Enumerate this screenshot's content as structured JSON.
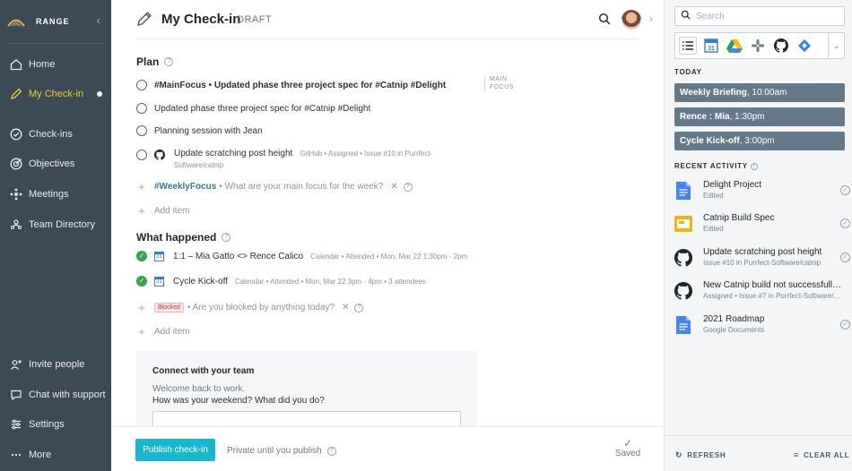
{
  "sidebar": {
    "brand": "RANGE",
    "top_items": [
      {
        "label": "Home",
        "icon": "home-icon"
      },
      {
        "label": "My Check-in",
        "icon": "pencil-icon",
        "active": true
      },
      {
        "label": "Check-ins",
        "icon": "check-circle-icon"
      },
      {
        "label": "Objectives",
        "icon": "target-icon"
      },
      {
        "label": "Meetings",
        "icon": "meetings-icon"
      },
      {
        "label": "Team Directory",
        "icon": "team-icon"
      }
    ],
    "bottom_items": [
      {
        "label": "Invite people",
        "icon": "invite-icon"
      },
      {
        "label": "Chat with support",
        "icon": "chat-icon"
      },
      {
        "label": "Settings",
        "icon": "settings-icon"
      },
      {
        "label": "More",
        "icon": "more-icon"
      }
    ],
    "active_color": "#f4cf2f",
    "background": "#3b4a55"
  },
  "header": {
    "title": "My Check-in",
    "status": "DRAFT"
  },
  "plan": {
    "heading": "Plan",
    "main_focus_label": "MAIN FOCUS",
    "items": [
      {
        "text": "#MainFocus • Updated phase three project spec for #Catnip #Delight"
      },
      {
        "text": "Updated phase three project spec for #Catnip #Delight"
      },
      {
        "text": "Planning session with Jean"
      },
      {
        "text": "Update scratching post height",
        "meta1": "GitHub • Assigned • Issue #10 in Purrfect-",
        "meta2": "Software/catnip"
      }
    ],
    "weekly_focus_tag": "#WeeklyFocus",
    "weekly_focus_placeholder": "• What are your main focus for the week?",
    "add_item": "Add item"
  },
  "what_happened": {
    "heading": "What happened",
    "items": [
      {
        "text": "1:1 – Mia Gatto <> Rence Calico",
        "meta": "Calendar • Attended • Mon, Mar 22 1:30pm - 2pm"
      },
      {
        "text": "Cycle Kick-off",
        "meta": "Calendar • Attended • Mon, Mar 22 3pm - 4pm • 3 attendees"
      }
    ],
    "blocked_tag": "Blocked",
    "blocked_placeholder": "• Are you blocked by anything today?",
    "add_item": "Add item"
  },
  "connect": {
    "heading": "Connect with your team",
    "line1": "Welcome back to work.",
    "line2": "How was your weekend? What did you do?"
  },
  "footer": {
    "publish": "Publish check-in",
    "private": "Private until you publish",
    "saved": "Saved"
  },
  "right": {
    "search_placeholder": "Search",
    "integrations": [
      "list-icon",
      "calendar-icon",
      "drive-icon",
      "slack-icon",
      "github-icon",
      "jira-icon"
    ],
    "today_label": "TODAY",
    "meetings": [
      {
        "name": "Weekly Briefing",
        "time": ", 10:00am"
      },
      {
        "name": "Rence : Mia",
        "time": ", 1:30pm"
      },
      {
        "name": "Cycle Kick-off",
        "time": ", 3:00pm"
      }
    ],
    "recent_label": "RECENT ACTIVITY",
    "activity": [
      {
        "title": "Delight Project",
        "sub": "Edited",
        "icon": "google-doc-icon"
      },
      {
        "title": "Catnip Build Spec",
        "sub": "Edited",
        "icon": "google-slides-icon"
      },
      {
        "title": "Update scratching post height",
        "sub": "Issue #10 in Purrfect-Software/catnip",
        "icon": "github-icon"
      },
      {
        "title": "New Catnip build not successfully r...",
        "sub": "Assigned • Issue #7 in Purrfect-Software/...",
        "icon": "github-icon"
      },
      {
        "title": "2021 Roadmap",
        "sub": "Google Documents",
        "icon": "google-doc-icon"
      }
    ],
    "refresh": "REFRESH",
    "clear_all": "CLEAR ALL"
  }
}
